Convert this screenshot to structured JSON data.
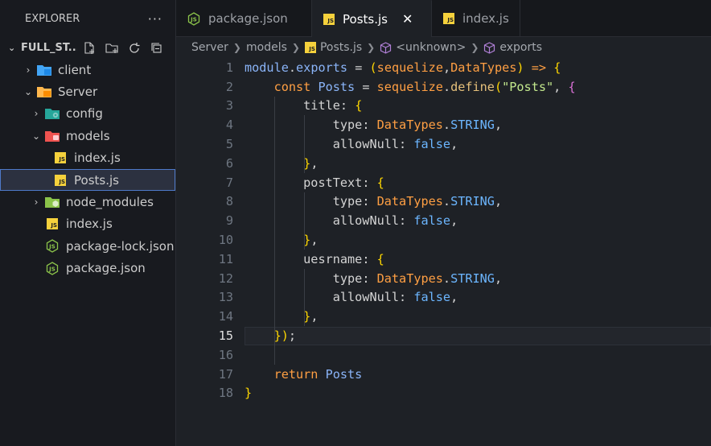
{
  "sidebar": {
    "title": "EXPLORER",
    "more": "···",
    "root_name": "FULL_ST...",
    "items": [
      {
        "label": "client",
        "type": "folder",
        "expanded": false
      },
      {
        "label": "Server",
        "type": "folder",
        "expanded": true
      },
      {
        "label": "config",
        "type": "folder",
        "expanded": false
      },
      {
        "label": "models",
        "type": "folder",
        "expanded": true
      },
      {
        "label": "index.js",
        "type": "js"
      },
      {
        "label": "Posts.js",
        "type": "js",
        "selected": true
      },
      {
        "label": "node_modules",
        "type": "folder",
        "expanded": false
      },
      {
        "label": "index.js",
        "type": "js"
      },
      {
        "label": "package-lock.json",
        "type": "json"
      },
      {
        "label": "package.json",
        "type": "json"
      }
    ]
  },
  "tabs": [
    {
      "label": "package.json",
      "icon": "nodejs-icon",
      "active": false
    },
    {
      "label": "Posts.js",
      "icon": "js-icon",
      "active": true,
      "close": "✕"
    },
    {
      "label": "index.js",
      "icon": "js-icon",
      "active": false
    }
  ],
  "breadcrumb": {
    "items": [
      "Server",
      "models",
      "Posts.js",
      "<unknown>",
      "exports"
    ]
  },
  "editor": {
    "current_line": 15,
    "lines": [
      {
        "n": "1",
        "text": "module.exports = (sequelize,DataTypes) => {"
      },
      {
        "n": "2",
        "text": "    const Posts = sequelize.define(\"Posts\", {"
      },
      {
        "n": "3",
        "text": "        title: {"
      },
      {
        "n": "4",
        "text": "            type: DataTypes.STRING,"
      },
      {
        "n": "5",
        "text": "            allowNull: false,"
      },
      {
        "n": "6",
        "text": "        },"
      },
      {
        "n": "7",
        "text": "        postText: {"
      },
      {
        "n": "8",
        "text": "            type: DataTypes.STRING,"
      },
      {
        "n": "9",
        "text": "            allowNull: false,"
      },
      {
        "n": "10",
        "text": "        },"
      },
      {
        "n": "11",
        "text": "        uesrname: {"
      },
      {
        "n": "12",
        "text": "            type: DataTypes.STRING,"
      },
      {
        "n": "13",
        "text": "            allowNull: false,"
      },
      {
        "n": "14",
        "text": "        },"
      },
      {
        "n": "15",
        "text": "    });"
      },
      {
        "n": "16",
        "text": ""
      },
      {
        "n": "17",
        "text": "    return Posts"
      },
      {
        "n": "18",
        "text": "}"
      }
    ]
  },
  "colors": {
    "background": "#1e2126",
    "sidebar": "#181a1f",
    "js_badge": "#f5d13c",
    "selection_border": "#4e79c9"
  }
}
